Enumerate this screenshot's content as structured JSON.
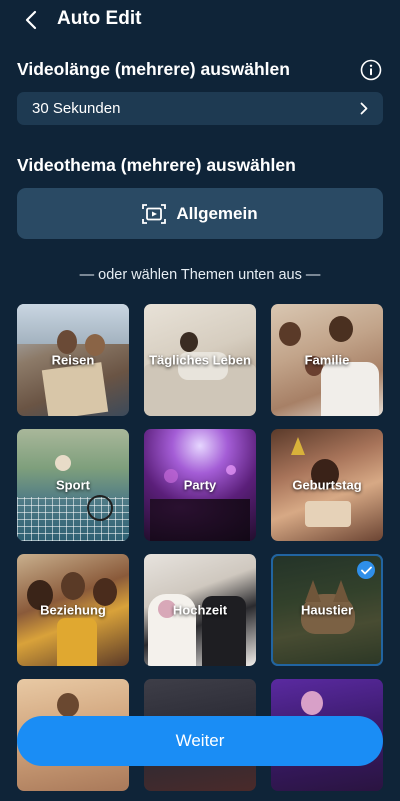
{
  "header": {
    "title": "Auto Edit"
  },
  "duration": {
    "title": "Videolänge (mehrere) auswählen",
    "selected": "30 Sekunden"
  },
  "theme": {
    "title": "Videothema (mehrere) auswählen",
    "general_label": "Allgemein",
    "or_text": "— oder wählen Themen unten aus —"
  },
  "tiles": [
    {
      "label": "Reisen",
      "selected": false
    },
    {
      "label": "Tägliches Leben",
      "selected": false
    },
    {
      "label": "Familie",
      "selected": false
    },
    {
      "label": "Sport",
      "selected": false
    },
    {
      "label": "Party",
      "selected": false
    },
    {
      "label": "Geburtstag",
      "selected": false
    },
    {
      "label": "Beziehung",
      "selected": false
    },
    {
      "label": "Hochzeit",
      "selected": false
    },
    {
      "label": "Haustier",
      "selected": true
    }
  ],
  "footer": {
    "next_label": "Weiter"
  },
  "colors": {
    "background": "#0f2438",
    "accent": "#1a8df5",
    "card": "#1e3a52"
  }
}
